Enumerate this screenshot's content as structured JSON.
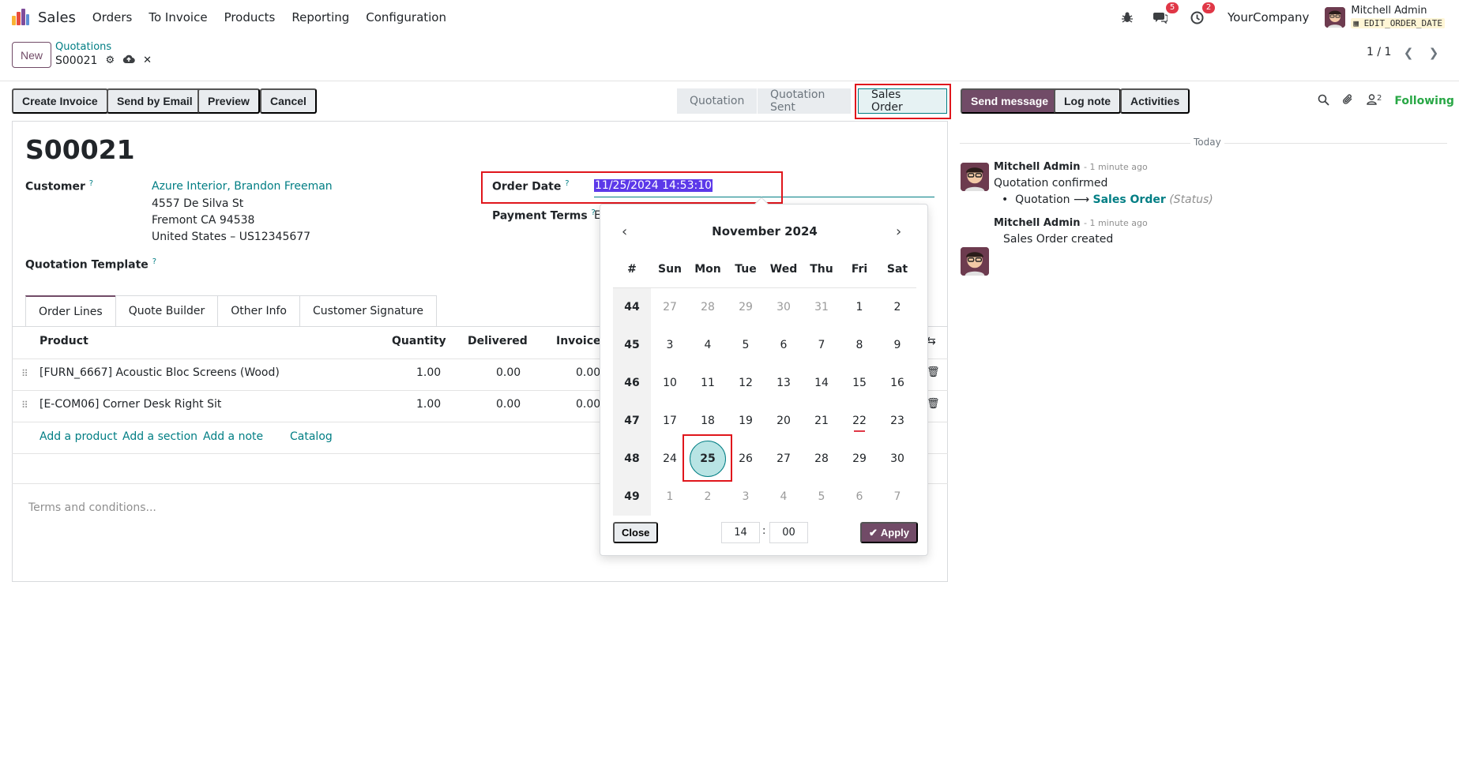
{
  "navbar": {
    "brand": "Sales",
    "menu": [
      "Orders",
      "To Invoice",
      "Products",
      "Reporting",
      "Configuration"
    ],
    "messages_badge": "5",
    "activities_badge": "2",
    "company": "YourCompany",
    "user_name": "Mitchell Admin",
    "user_db": "EDIT_ORDER_DATE"
  },
  "control_panel": {
    "new_label": "New",
    "breadcrumb_parent": "Quotations",
    "breadcrumb_current": "S00021",
    "pager": "1 / 1"
  },
  "actions": {
    "create_invoice": "Create Invoice",
    "send_by_email": "Send by Email",
    "preview": "Preview",
    "cancel": "Cancel"
  },
  "statusbar": [
    "Quotation",
    "Quotation Sent",
    "Sales Order"
  ],
  "record": {
    "name": "S00021",
    "customer_label": "Customer",
    "customer_name": "Azure Interior, Brandon Freeman",
    "address": [
      "4557 De Silva St",
      "Fremont CA 94538",
      "United States – US12345677"
    ],
    "quotation_template_label": "Quotation Template",
    "order_date_label": "Order Date",
    "order_date_value": "11/25/2024 14:53:10",
    "payment_terms_label": "Payment Terms",
    "payment_terms_value": "E"
  },
  "tabs": [
    "Order Lines",
    "Quote Builder",
    "Other Info",
    "Customer Signature"
  ],
  "order_lines": {
    "headers": [
      "Product",
      "Quantity",
      "Delivered",
      "Invoiced"
    ],
    "rows": [
      {
        "product": "[FURN_6667] Acoustic Bloc Screens (Wood)",
        "quantity": "1.00",
        "delivered": "0.00",
        "invoiced": "0.00"
      },
      {
        "product": "[E-COM06] Corner Desk Right Sit",
        "quantity": "1.00",
        "delivered": "0.00",
        "invoiced": "0.00"
      }
    ],
    "add_links": [
      "Add a product",
      "Add a section",
      "Add a note",
      "Catalog"
    ],
    "terms_placeholder": "Terms and conditions..."
  },
  "chatter": {
    "send_message": "Send message",
    "log_note": "Log note",
    "activities": "Activities",
    "followers_count": "2",
    "following": "Following",
    "today": "Today",
    "messages": [
      {
        "author": "Mitchell Admin",
        "time": "- 1 minute ago",
        "body": "Quotation confirmed",
        "tracking_old": "Quotation",
        "tracking_new": "Sales Order",
        "tracking_field": "(Status)"
      },
      {
        "author": "Mitchell Admin",
        "time": "- 1 minute ago",
        "body": "Sales Order created"
      }
    ]
  },
  "datepicker": {
    "title": "November 2024",
    "headers": [
      "#",
      "Sun",
      "Mon",
      "Tue",
      "Wed",
      "Thu",
      "Fri",
      "Sat"
    ],
    "weeks": [
      {
        "week": "44",
        "days": [
          "27",
          "28",
          "29",
          "30",
          "31",
          "1",
          "2"
        ],
        "out": [
          0,
          1,
          2,
          3,
          4
        ]
      },
      {
        "week": "45",
        "days": [
          "3",
          "4",
          "5",
          "6",
          "7",
          "8",
          "9"
        ],
        "out": []
      },
      {
        "week": "46",
        "days": [
          "10",
          "11",
          "12",
          "13",
          "14",
          "15",
          "16"
        ],
        "out": []
      },
      {
        "week": "47",
        "days": [
          "17",
          "18",
          "19",
          "20",
          "21",
          "22",
          "23"
        ],
        "out": [],
        "today": 5
      },
      {
        "week": "48",
        "days": [
          "24",
          "25",
          "26",
          "27",
          "28",
          "29",
          "30"
        ],
        "out": [],
        "selected": 1
      },
      {
        "week": "49",
        "days": [
          "1",
          "2",
          "3",
          "4",
          "5",
          "6",
          "7"
        ],
        "out": [
          0,
          1,
          2,
          3,
          4,
          5,
          6
        ]
      }
    ],
    "close_label": "Close",
    "hour": "14",
    "minute": "00",
    "colon": ":",
    "apply_label": "Apply"
  },
  "colors": {
    "primary": "#714b67",
    "link": "#017e84",
    "highlight": "#e0161c",
    "selection": "#5c39e9"
  }
}
